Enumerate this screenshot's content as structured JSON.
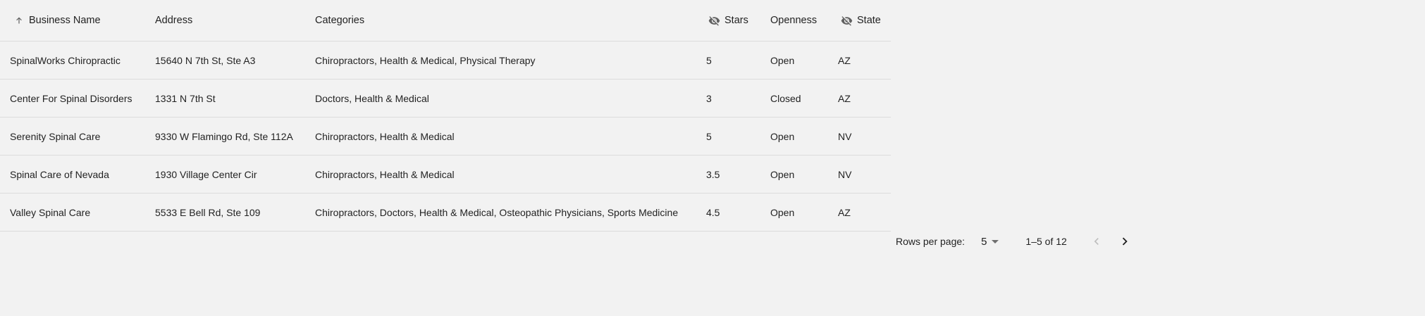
{
  "table": {
    "columns": {
      "name": "Business Name",
      "address": "Address",
      "categories": "Categories",
      "stars": "Stars",
      "openness": "Openness",
      "state": "State"
    },
    "rows": [
      {
        "name": "SpinalWorks Chiropractic",
        "address": "15640 N 7th St, Ste A3",
        "categories": "Chiropractors, Health & Medical, Physical Therapy",
        "stars": "5",
        "openness": "Open",
        "state": "AZ"
      },
      {
        "name": "Center For Spinal Disorders",
        "address": "1331 N 7th St",
        "categories": "Doctors, Health & Medical",
        "stars": "3",
        "openness": "Closed",
        "state": "AZ"
      },
      {
        "name": "Serenity Spinal Care",
        "address": "9330 W Flamingo Rd, Ste 112A",
        "categories": "Chiropractors, Health & Medical",
        "stars": "5",
        "openness": "Open",
        "state": "NV"
      },
      {
        "name": "Spinal Care of Nevada",
        "address": "1930 Village Center Cir",
        "categories": "Chiropractors, Health & Medical",
        "stars": "3.5",
        "openness": "Open",
        "state": "NV"
      },
      {
        "name": "Valley Spinal Care",
        "address": "5533 E Bell Rd, Ste 109",
        "categories": "Chiropractors, Doctors, Health & Medical, Osteopathic Physicians, Sports Medicine",
        "stars": "4.5",
        "openness": "Open",
        "state": "AZ"
      }
    ]
  },
  "pagination": {
    "rows_per_page_label": "Rows per page:",
    "rows_per_page": "5",
    "range": "1–5 of 12"
  },
  "icons": {
    "sort": "arrow-up-icon",
    "hidden": "visibility-off-icon",
    "prev": "chevron-left-icon",
    "next": "chevron-right-icon"
  },
  "colors": {
    "background": "#f2f2f2",
    "text": "#212121",
    "divider": "#dcdcdc",
    "disabled": "#bdbdbd"
  }
}
